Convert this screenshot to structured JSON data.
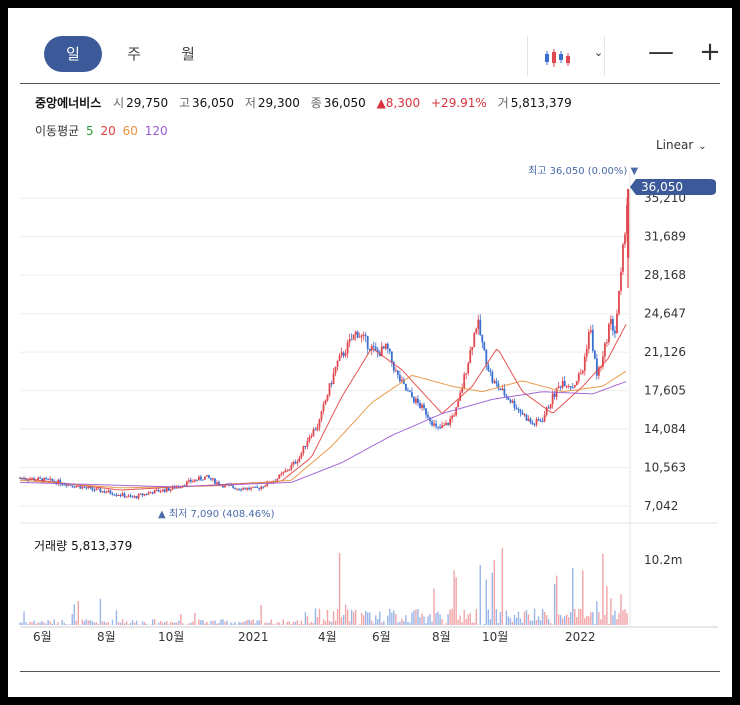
{
  "tabs": [
    {
      "label": "일",
      "active": true
    },
    {
      "label": "주",
      "active": false
    },
    {
      "label": "월",
      "active": false
    }
  ],
  "toolbar": {
    "chart_type_icon": "candlestick-icon",
    "dropdown_icon": "chevron-down-icon",
    "zoom_out": "—",
    "zoom_in": "+"
  },
  "stock": {
    "name": "중앙에너비스",
    "open_label": "시",
    "open": "29,750",
    "high_label": "고",
    "high": "36,050",
    "low_label": "저",
    "low": "29,300",
    "close_label": "종",
    "close": "36,050",
    "change": "▲8,300",
    "change_pct": "+29.91%",
    "volume_label": "거",
    "volume": "5,813,379"
  },
  "moving_average": {
    "label": "이동평균",
    "periods": [
      {
        "label": "5",
        "color": "#2e9e3e"
      },
      {
        "label": "20",
        "color": "#e0413e"
      },
      {
        "label": "60",
        "color": "#e8913a"
      },
      {
        "label": "120",
        "color": "#9b59d0"
      }
    ]
  },
  "scale_mode": "Linear",
  "volume_panel": {
    "label": "거래량",
    "value": "5,813,379",
    "max_label": "10.2m"
  },
  "colors": {
    "up": "#e0474f",
    "down": "#3a6ed0",
    "accent": "#3c5a9a"
  },
  "chart_data": {
    "type": "candlestick",
    "y_ticks": [
      "35,210",
      "31,689",
      "28,168",
      "24,647",
      "21,126",
      "17,605",
      "14,084",
      "10,563",
      "7,042"
    ],
    "ylim": [
      7042,
      36050
    ],
    "x_ticks": [
      "6월",
      "8월",
      "10월",
      "2021",
      "4월",
      "6월",
      "8월",
      "10월",
      "2022"
    ],
    "price_tag": "36,050",
    "high_annotation": "최고 36,050 (0.00%) ▼",
    "low_annotation": "▲ 최저 7,090 (408.46%)",
    "close_series": [
      {
        "i": 0,
        "v": 9600
      },
      {
        "i": 15,
        "v": 9500
      },
      {
        "i": 35,
        "v": 9300
      },
      {
        "i": 55,
        "v": 8900
      },
      {
        "i": 75,
        "v": 8500
      },
      {
        "i": 95,
        "v": 8200
      },
      {
        "i": 112,
        "v": 7800
      },
      {
        "i": 130,
        "v": 8300
      },
      {
        "i": 150,
        "v": 8600
      },
      {
        "i": 170,
        "v": 9300
      },
      {
        "i": 185,
        "v": 9700
      },
      {
        "i": 200,
        "v": 9000
      },
      {
        "i": 215,
        "v": 8700
      },
      {
        "i": 235,
        "v": 8600
      },
      {
        "i": 255,
        "v": 9500
      },
      {
        "i": 268,
        "v": 10500
      },
      {
        "i": 278,
        "v": 11500
      },
      {
        "i": 288,
        "v": 13500
      },
      {
        "i": 297,
        "v": 14500
      },
      {
        "i": 305,
        "v": 17000
      },
      {
        "i": 315,
        "v": 20000
      },
      {
        "i": 325,
        "v": 21500
      },
      {
        "i": 335,
        "v": 23000
      },
      {
        "i": 345,
        "v": 22000
      },
      {
        "i": 355,
        "v": 21000
      },
      {
        "i": 365,
        "v": 21500
      },
      {
        "i": 375,
        "v": 19000
      },
      {
        "i": 385,
        "v": 17500
      },
      {
        "i": 395,
        "v": 16500
      },
      {
        "i": 405,
        "v": 15500
      },
      {
        "i": 415,
        "v": 14000
      },
      {
        "i": 425,
        "v": 14500
      },
      {
        "i": 435,
        "v": 16000
      },
      {
        "i": 445,
        "v": 20000
      },
      {
        "i": 455,
        "v": 24000
      },
      {
        "i": 462,
        "v": 21000
      },
      {
        "i": 470,
        "v": 18500
      },
      {
        "i": 480,
        "v": 17500
      },
      {
        "i": 490,
        "v": 16500
      },
      {
        "i": 500,
        "v": 15500
      },
      {
        "i": 510,
        "v": 14500
      },
      {
        "i": 520,
        "v": 15000
      },
      {
        "i": 530,
        "v": 17000
      },
      {
        "i": 540,
        "v": 18500
      },
      {
        "i": 550,
        "v": 18000
      },
      {
        "i": 560,
        "v": 19500
      },
      {
        "i": 567,
        "v": 23500
      },
      {
        "i": 574,
        "v": 19000
      },
      {
        "i": 580,
        "v": 20500
      },
      {
        "i": 587,
        "v": 24000
      },
      {
        "i": 592,
        "v": 23000
      },
      {
        "i": 598,
        "v": 28000
      },
      {
        "i": 605,
        "v": 36050
      }
    ],
    "ma_series": {
      "20": [
        {
          "i": 0,
          "v": 9600
        },
        {
          "i": 100,
          "v": 8500
        },
        {
          "i": 200,
          "v": 9000
        },
        {
          "i": 260,
          "v": 9300
        },
        {
          "i": 290,
          "v": 11500
        },
        {
          "i": 320,
          "v": 17000
        },
        {
          "i": 350,
          "v": 21500
        },
        {
          "i": 380,
          "v": 19500
        },
        {
          "i": 420,
          "v": 15500
        },
        {
          "i": 450,
          "v": 18000
        },
        {
          "i": 475,
          "v": 21500
        },
        {
          "i": 500,
          "v": 17500
        },
        {
          "i": 530,
          "v": 15500
        },
        {
          "i": 560,
          "v": 18000
        },
        {
          "i": 585,
          "v": 20500
        },
        {
          "i": 605,
          "v": 24000
        }
      ],
      "60": [
        {
          "i": 0,
          "v": 9400
        },
        {
          "i": 100,
          "v": 8700
        },
        {
          "i": 200,
          "v": 8900
        },
        {
          "i": 270,
          "v": 9400
        },
        {
          "i": 310,
          "v": 12500
        },
        {
          "i": 350,
          "v": 16500
        },
        {
          "i": 390,
          "v": 19000
        },
        {
          "i": 430,
          "v": 18000
        },
        {
          "i": 460,
          "v": 17500
        },
        {
          "i": 500,
          "v": 18500
        },
        {
          "i": 540,
          "v": 17500
        },
        {
          "i": 580,
          "v": 18000
        },
        {
          "i": 605,
          "v": 19500
        }
      ],
      "120": [
        {
          "i": 0,
          "v": 9200
        },
        {
          "i": 150,
          "v": 8800
        },
        {
          "i": 270,
          "v": 9200
        },
        {
          "i": 320,
          "v": 11000
        },
        {
          "i": 370,
          "v": 13500
        },
        {
          "i": 420,
          "v": 15500
        },
        {
          "i": 470,
          "v": 16800
        },
        {
          "i": 520,
          "v": 17500
        },
        {
          "i": 570,
          "v": 17300
        },
        {
          "i": 605,
          "v": 18500
        }
      ]
    }
  }
}
